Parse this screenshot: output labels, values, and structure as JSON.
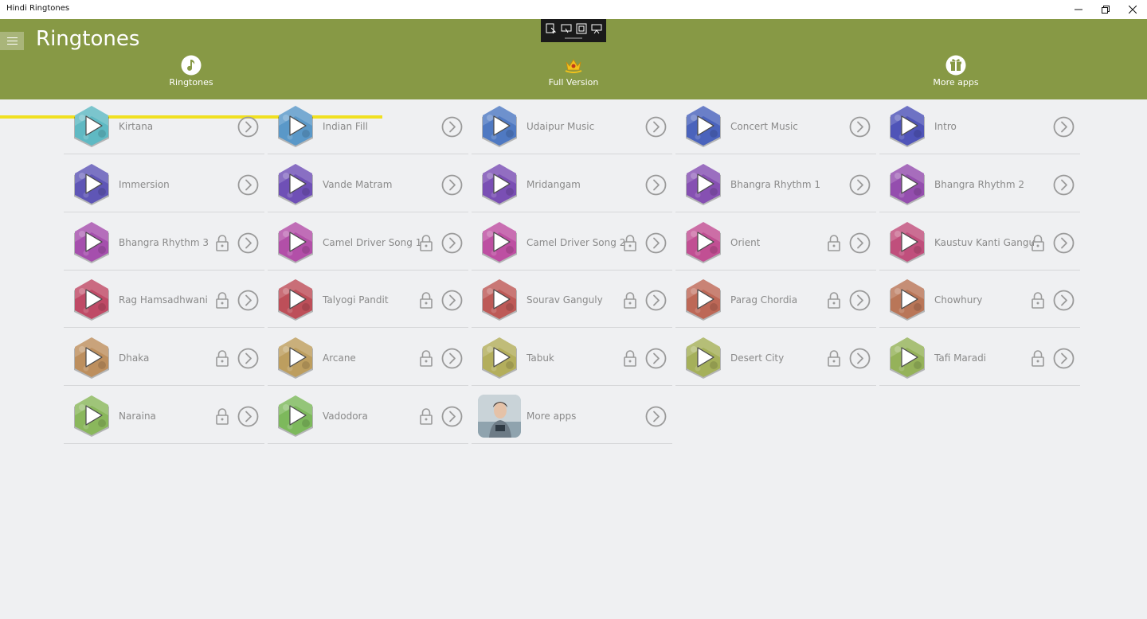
{
  "window": {
    "title": "Hindi Ringtones"
  },
  "header": {
    "title": "Ringtones",
    "tabs": [
      {
        "label": "Ringtones",
        "icon": "music-note-icon"
      },
      {
        "label": "Full Version",
        "icon": "crown-icon"
      },
      {
        "label": "More apps",
        "icon": "gift-icon"
      }
    ],
    "selected_tab": "Ringtones"
  },
  "colors": {
    "header": "#879945",
    "tab_indicator": "#f0e020",
    "background": "#eff0f2",
    "text": "#8a8a8a"
  },
  "tiles": [
    {
      "label": "Kirtana",
      "locked": false,
      "color": "#5fb9c3"
    },
    {
      "label": "Indian Fill",
      "locked": false,
      "color": "#5a98c8"
    },
    {
      "label": "Udaipur Music",
      "locked": false,
      "color": "#4f79c2"
    },
    {
      "label": "Concert Music",
      "locked": false,
      "color": "#4a63bc"
    },
    {
      "label": "Intro",
      "locked": false,
      "color": "#4f54b8"
    },
    {
      "label": "Immersion",
      "locked": false,
      "color": "#5f56b6"
    },
    {
      "label": "Vande Matram",
      "locked": false,
      "color": "#6f50b6"
    },
    {
      "label": "Mridangam",
      "locked": false,
      "color": "#7a4fb4"
    },
    {
      "label": "Bhangra Rhythm 1",
      "locked": false,
      "color": "#8650b2"
    },
    {
      "label": "Bhangra Rhythm 2",
      "locked": false,
      "color": "#944eae"
    },
    {
      "label": "Bhangra Rhythm 3",
      "locked": true,
      "color": "#a54fad"
    },
    {
      "label": "Camel Driver Song 1",
      "locked": true,
      "color": "#b24fa8"
    },
    {
      "label": "Camel Driver Song 2",
      "locked": true,
      "color": "#bd4fa2"
    },
    {
      "label": "Orient",
      "locked": true,
      "color": "#c14f93"
    },
    {
      "label": "Kaustuv Kanti Gangu",
      "locked": true,
      "color": "#c04f7c"
    },
    {
      "label": "Rag Hamsadhwani",
      "locked": true,
      "color": "#bf4a66"
    },
    {
      "label": "Talyogi Pandit",
      "locked": true,
      "color": "#bd4f59"
    },
    {
      "label": "Sourav Ganguly",
      "locked": true,
      "color": "#bd5a57"
    },
    {
      "label": "Parag Chordia",
      "locked": true,
      "color": "#bd6857"
    },
    {
      "label": "Chowhury",
      "locked": true,
      "color": "#b97658"
    },
    {
      "label": "Dhaka",
      "locked": true,
      "color": "#bd8f5e"
    },
    {
      "label": "Arcane",
      "locked": true,
      "color": "#bd9e5f"
    },
    {
      "label": "Tabuk",
      "locked": true,
      "color": "#b3ae5c"
    },
    {
      "label": "Desert City",
      "locked": true,
      "color": "#a5b05a"
    },
    {
      "label": "Tafi Maradi",
      "locked": true,
      "color": "#95b25a"
    },
    {
      "label": "Naraina",
      "locked": true,
      "color": "#8ab75c"
    },
    {
      "label": "Vadodora",
      "locked": true,
      "color": "#7db95c"
    },
    {
      "label": "More apps",
      "locked": false,
      "photo": true
    }
  ]
}
